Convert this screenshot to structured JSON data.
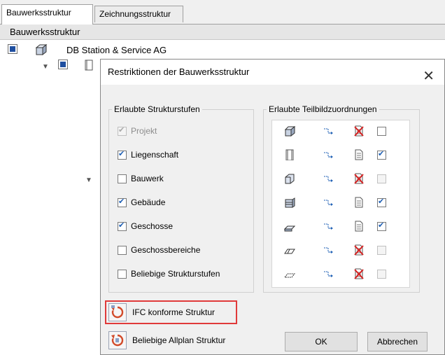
{
  "tabs": [
    "Bauwerksstruktur",
    "Zeichnungsstruktur"
  ],
  "header_title": "Bauwerksstruktur",
  "tree_root_label": "DB Station & Service AG",
  "dialog": {
    "title": "Restriktionen der Bauwerksstruktur",
    "left_group_title": "Erlaubte Strukturstufen",
    "right_group_title": "Erlaubte Teilbildzuordnungen",
    "levels": [
      {
        "label": "Projekt",
        "checked": true,
        "disabled": true
      },
      {
        "label": "Liegenschaft",
        "checked": true,
        "disabled": false
      },
      {
        "label": "Bauwerk",
        "checked": false,
        "disabled": false
      },
      {
        "label": "Gebäude",
        "checked": true,
        "disabled": false
      },
      {
        "label": "Geschosse",
        "checked": true,
        "disabled": false
      },
      {
        "label": "Geschossbereiche",
        "checked": false,
        "disabled": false
      },
      {
        "label": "Beliebige Strukturstufen",
        "checked": false,
        "disabled": false
      }
    ],
    "assignments": [
      {
        "level_icon": "project-icon",
        "doc_icon": "no-document-icon",
        "checked": false,
        "disabled": false
      },
      {
        "level_icon": "site-icon",
        "doc_icon": "document-icon",
        "checked": true,
        "disabled": false
      },
      {
        "level_icon": "structure-icon",
        "doc_icon": "no-document-icon",
        "checked": false,
        "disabled": true
      },
      {
        "level_icon": "building-icon",
        "doc_icon": "document-icon",
        "checked": true,
        "disabled": false
      },
      {
        "level_icon": "storey-icon",
        "doc_icon": "document-icon",
        "checked": true,
        "disabled": false
      },
      {
        "level_icon": "storey-area-icon",
        "doc_icon": "no-document-icon",
        "checked": false,
        "disabled": true
      },
      {
        "level_icon": "any-level-icon",
        "doc_icon": "no-document-icon",
        "checked": false,
        "disabled": true
      }
    ],
    "ifc_button_label": "IFC konforme Struktur",
    "allplan_button_label": "Beliebige Allplan Struktur",
    "ok_label": "OK",
    "cancel_label": "Abbrechen"
  },
  "colors": {
    "highlight": "#e03a3a",
    "check": "#1e5fb4"
  }
}
